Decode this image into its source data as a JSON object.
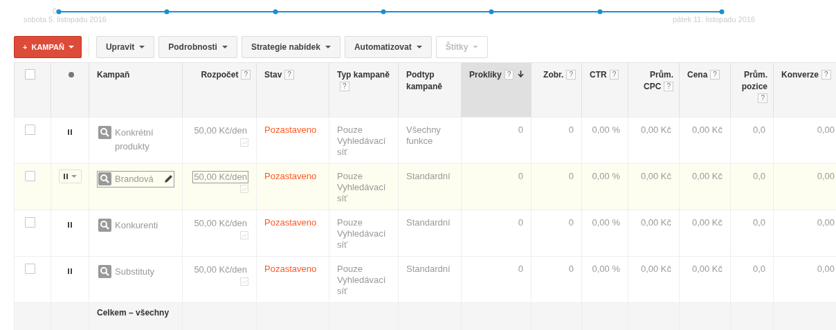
{
  "chart": {
    "y_tick": "0",
    "start_label": "sobota 5. listopadu 2016",
    "end_label": "pátek 11. listopadu 2016"
  },
  "toolbar": {
    "primary": {
      "label": "KAMPAŇ",
      "icon": "+"
    },
    "buttons": [
      {
        "label": "Upravit",
        "disabled": false
      },
      {
        "label": "Podrobnosti",
        "disabled": false
      },
      {
        "label": "Strategie nabídek",
        "disabled": false
      },
      {
        "label": "Automatizovat",
        "disabled": false
      },
      {
        "label": "Štítky",
        "disabled": true
      }
    ]
  },
  "table": {
    "columns": [
      {
        "label": "Kampaň",
        "sorted": false
      },
      {
        "label": "Rozpočet",
        "help": "?",
        "sorted": false
      },
      {
        "label": "Stav",
        "help": "?",
        "sorted": false
      },
      {
        "label": "Typ kampaně",
        "help": "?",
        "sorted": false
      },
      {
        "label": "Podtyp kampaně",
        "sorted": false
      },
      {
        "label": "Prokliky",
        "help": "?",
        "sorted": true
      },
      {
        "label": "Zobr.",
        "help": "?",
        "sorted": false
      },
      {
        "label": "CTR",
        "help": "?",
        "sorted": false
      },
      {
        "label": "Prům. CPC",
        "help": "?",
        "sorted": false
      },
      {
        "label": "Cena",
        "help": "?",
        "sorted": false
      },
      {
        "label": "Prům. pozice",
        "help": "?",
        "sorted": false
      },
      {
        "label": "Konverze",
        "help": "?",
        "sorted": false
      }
    ],
    "header_checked": false,
    "rows": [
      {
        "checked": false,
        "highlighted": false,
        "name": "Konkrétní produkty",
        "budget": "50,00 Kč/den",
        "state": "Pozastaveno",
        "type": "Pouze Vyhledávací síť",
        "subtype": "Všechny funkce",
        "metrics": [
          "0",
          "0",
          "0,00 %",
          "0,00 Kč",
          "0,00 Kč",
          "0,0",
          "0,00"
        ]
      },
      {
        "checked": false,
        "highlighted": true,
        "name": "Brandová",
        "budget": "50,00 Kč/den",
        "state": "Pozastaveno",
        "type": "Pouze Vyhledávací síť",
        "subtype": "Standardní",
        "metrics": [
          "0",
          "0",
          "0,00 %",
          "0,00 Kč",
          "0,00 Kč",
          "0,0",
          "0,00"
        ]
      },
      {
        "checked": false,
        "highlighted": false,
        "name": "Konkurenti",
        "budget": "50,00 Kč/den",
        "state": "Pozastaveno",
        "type": "Pouze Vyhledávací síť",
        "subtype": "Standardní",
        "metrics": [
          "0",
          "0",
          "0,00 %",
          "0,00 Kč",
          "0,00 Kč",
          "0,0",
          "0,00"
        ]
      },
      {
        "checked": false,
        "highlighted": false,
        "name": "Substituty",
        "budget": "50,00 Kč/den",
        "state": "Pozastaveno",
        "type": "Pouze Vyhledávací síť",
        "subtype": "Standardní",
        "metrics": [
          "0",
          "0",
          "0,00 %",
          "0,00 Kč",
          "0,00 Kč",
          "0,0",
          "0,00"
        ]
      }
    ],
    "total_label": "Celkem – všechny"
  }
}
